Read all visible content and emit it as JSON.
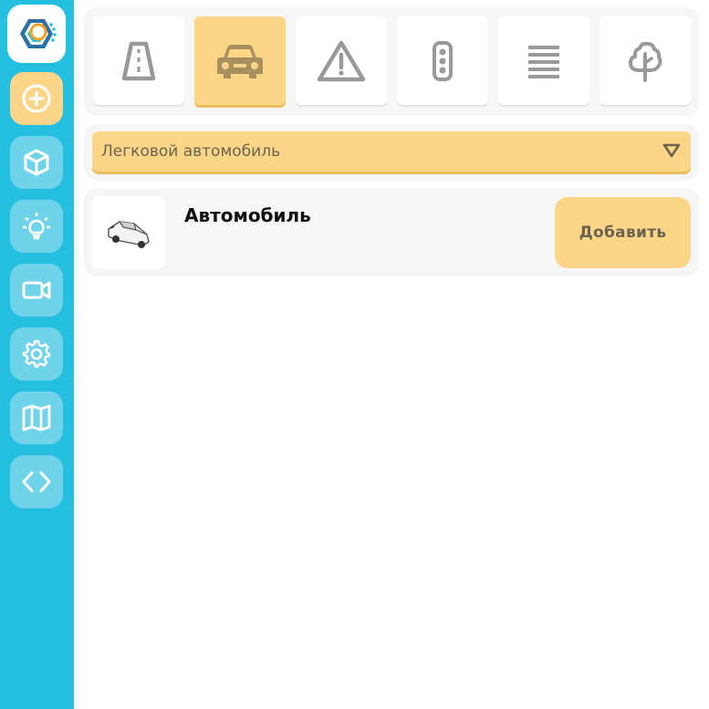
{
  "sidebar": {
    "logo_icon": "app-logo",
    "buttons": [
      {
        "icon": "plus-circle-icon",
        "active": true
      },
      {
        "icon": "cube-icon",
        "active": false
      },
      {
        "icon": "lightbulb-icon",
        "active": false
      },
      {
        "icon": "video-camera-icon",
        "active": false
      },
      {
        "icon": "gear-icon",
        "active": false
      },
      {
        "icon": "map-icon",
        "active": false
      },
      {
        "icon": "code-icon",
        "active": false
      }
    ]
  },
  "categories": [
    {
      "icon": "road-icon",
      "active": false
    },
    {
      "icon": "car-icon",
      "active": true
    },
    {
      "icon": "warning-sign-icon",
      "active": false
    },
    {
      "icon": "traffic-light-icon",
      "active": false
    },
    {
      "icon": "crosswalk-icon",
      "active": false
    },
    {
      "icon": "tree-icon",
      "active": false
    }
  ],
  "type_select": {
    "value": "Легковой автомобиль"
  },
  "item": {
    "title": "Автомобиль",
    "add_label": "Добавить"
  },
  "colors": {
    "sidebar": "#25c0e0",
    "accent": "#fcd688",
    "active_icon": "#a8905e"
  }
}
